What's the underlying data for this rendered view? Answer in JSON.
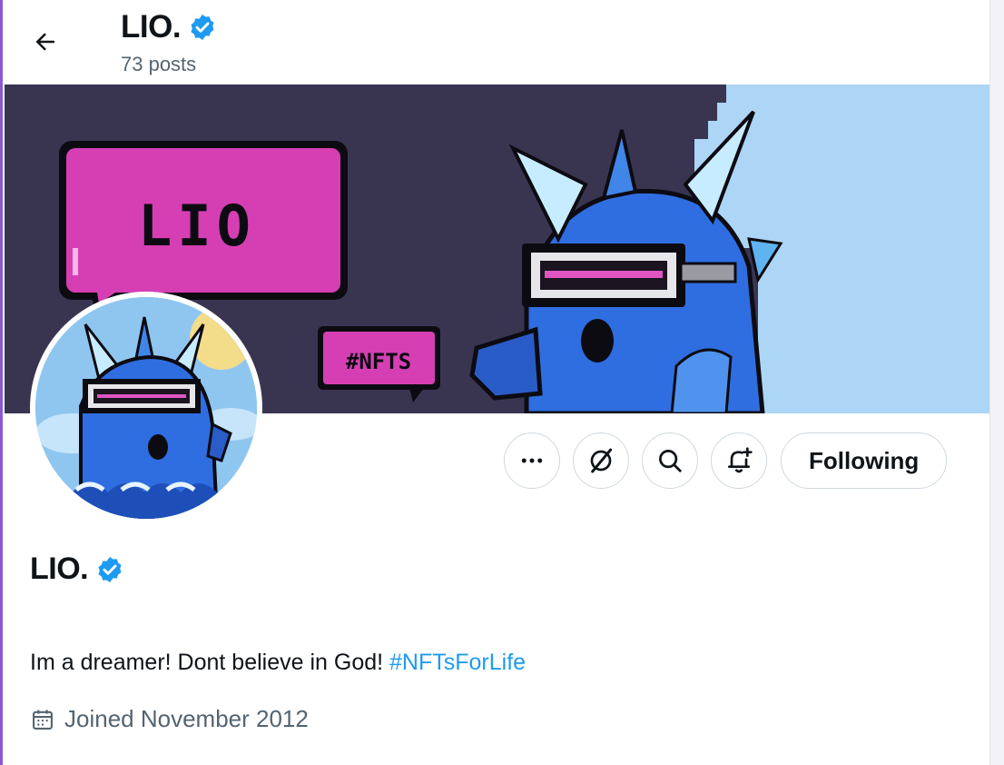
{
  "header": {
    "name": "LIO.",
    "posts": "73 posts"
  },
  "banner": {
    "speech_text": "LIO",
    "hashtag_text": "#NFTS",
    "colors": {
      "background": "#393551",
      "sky": "#add5f5",
      "pink": "#d63fb4",
      "bird": "#2f6ee0"
    }
  },
  "actions": {
    "more_icon": "ellipsis-icon",
    "grok_icon": "grok-icon",
    "search_icon": "search-icon",
    "notify_icon": "bell-plus-icon",
    "follow_label": "Following"
  },
  "profile": {
    "name": "LIO.",
    "bio_text": "Im a dreamer! Dont believe in God! ",
    "bio_hashtag": "#NFTsForLife",
    "joined": "Joined November 2012"
  },
  "colors": {
    "verified": "#1d9bf0",
    "link": "#1d9bf0",
    "muted": "#536471"
  }
}
